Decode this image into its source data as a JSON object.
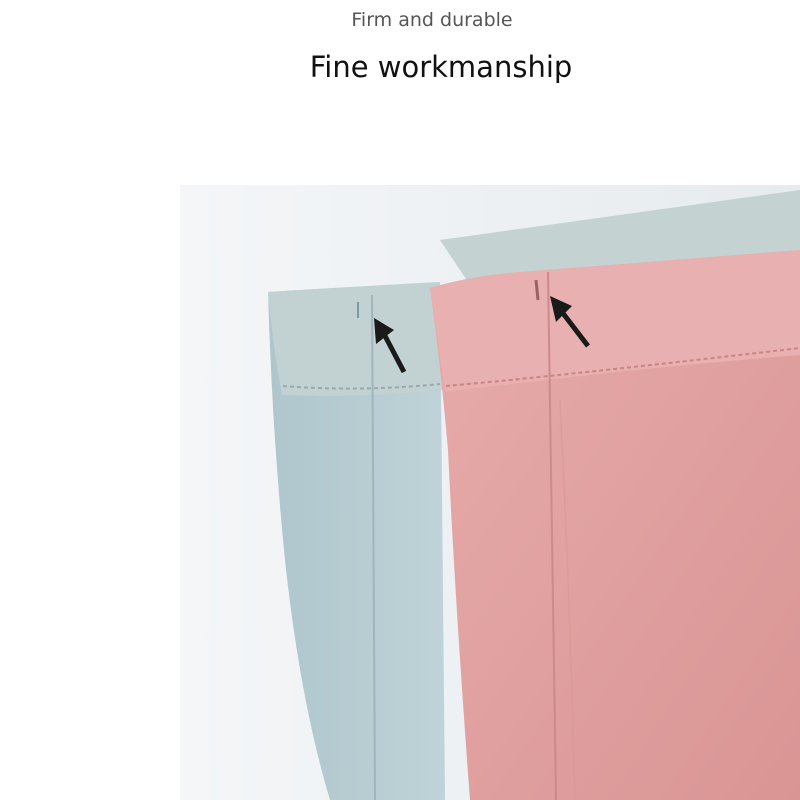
{
  "header": {
    "subtitle": "Firm and durable",
    "title": "Fine workmanship"
  },
  "photo": {
    "subject": "two folded cotton boxer briefs with stitched waistbands",
    "colors": {
      "background": "#ffffff",
      "blue_fabric": "#b7cdd3",
      "blue_band": "#c3d1d3",
      "pink_fabric": "#e3a6a5",
      "pink_band": "#e7aeae",
      "arrow": "#1a1a1a"
    },
    "icons": [
      "arrow-icon",
      "arrow-icon"
    ]
  }
}
